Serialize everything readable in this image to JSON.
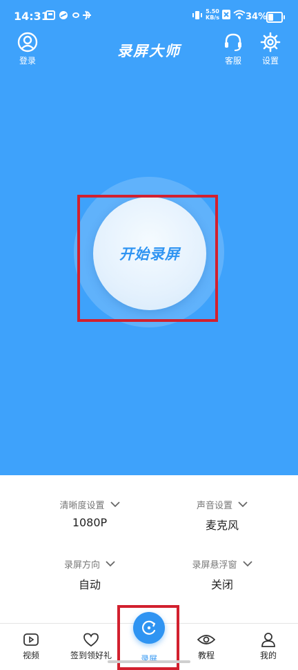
{
  "status_bar": {
    "time": "14:31",
    "net_speed_value": "5.50",
    "net_speed_unit": "KB/s",
    "battery_text": "34%",
    "battery_level": 0.34
  },
  "header": {
    "title": "录屏大师",
    "login_label": "登录",
    "service_label": "客服",
    "settings_label": "设置"
  },
  "main": {
    "record_button_label": "开始录屏"
  },
  "settings": {
    "clarity": {
      "label": "清晰度设置",
      "value": "1080P"
    },
    "sound": {
      "label": "声音设置",
      "value": "麦克风"
    },
    "orientation": {
      "label": "录屏方向",
      "value": "自动"
    },
    "floating_window": {
      "label": "录屏悬浮窗",
      "value": "关闭"
    }
  },
  "tabbar": {
    "video": "视频",
    "checkin": "签到领好礼",
    "record": "录屏",
    "tutorial": "教程",
    "mine": "我的"
  },
  "colors": {
    "primary_blue": "#3ea2fb",
    "accent_blue": "#2f94f2",
    "highlight_red": "#d2202e"
  },
  "icons": [
    "user-circle-icon",
    "headset-icon",
    "gear-icon",
    "play-icon",
    "heart-icon",
    "refresh-camera-icon",
    "eye-icon",
    "person-icon",
    "chevron-down-icon"
  ]
}
